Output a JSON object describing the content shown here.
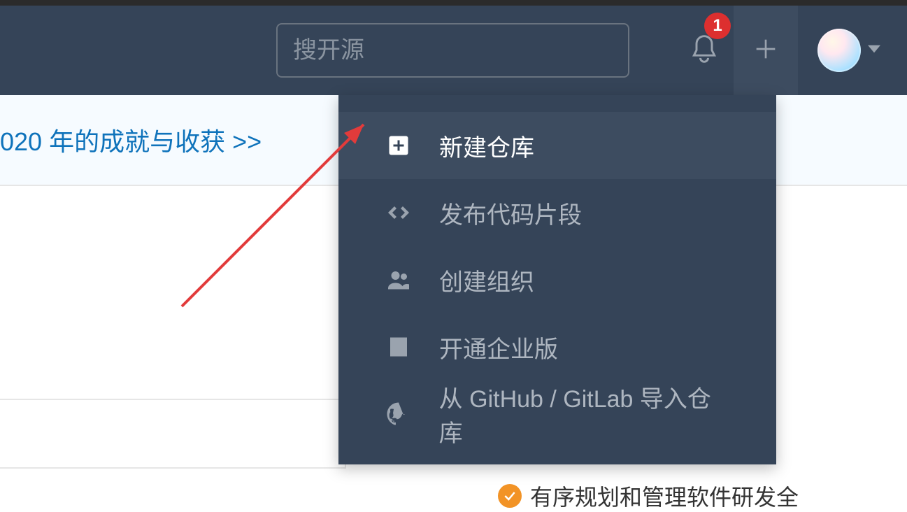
{
  "navbar": {
    "search_placeholder": "搜开源",
    "notification_count": "1"
  },
  "banner": {
    "link_text": "020 年的成就与收获 >>"
  },
  "dropdown": {
    "items": [
      {
        "label": "新建仓库"
      },
      {
        "label": "发布代码片段"
      },
      {
        "label": "创建组织"
      },
      {
        "label": "开通企业版"
      },
      {
        "label": "从 GitHub / GitLab 导入仓库"
      }
    ]
  },
  "footer": {
    "note_text": "有序规划和管理软件研发全"
  }
}
